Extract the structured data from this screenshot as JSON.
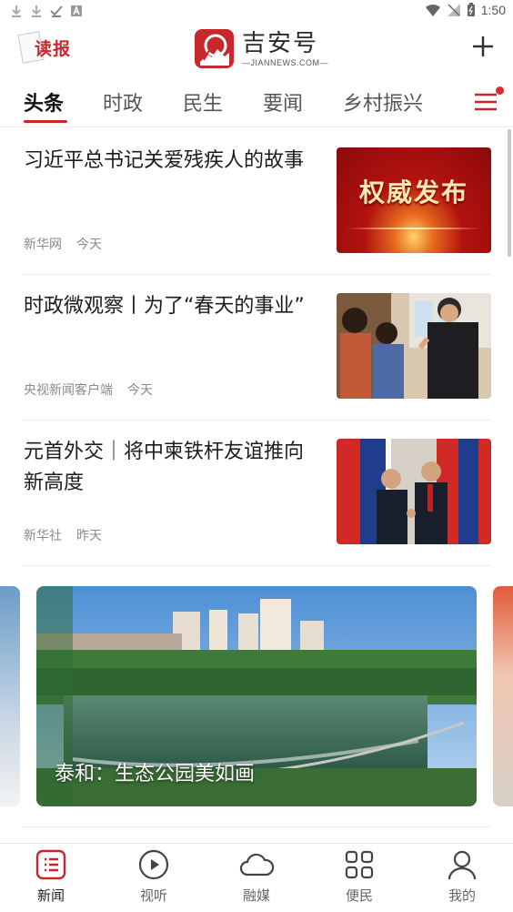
{
  "status_bar": {
    "time": "1:50"
  },
  "header": {
    "left_badge": "读报",
    "brand_title": "吉安号",
    "brand_subtitle": "—JIANNEWS.COM—"
  },
  "tabs": [
    {
      "label": "头条",
      "active": true
    },
    {
      "label": "时政"
    },
    {
      "label": "民生"
    },
    {
      "label": "要闻"
    },
    {
      "label": "乡村振兴"
    }
  ],
  "articles": [
    {
      "title": "习近平总书记关爱残疾人的故事",
      "source": "新华网",
      "time": "今天",
      "thumb_text": "权威发布"
    },
    {
      "title": "时政微观察丨为了“春天的事业”",
      "source": "央视新闻客户端",
      "time": "今天"
    },
    {
      "title": "元首外交｜将中柬铁杆友谊推向新高度",
      "source": "新华社",
      "time": "昨天"
    }
  ],
  "carousel": {
    "caption": "泰和：生态公园美如画"
  },
  "bottom_nav": [
    {
      "label": "新闻",
      "icon": "news-list-icon",
      "active": true
    },
    {
      "label": "视听",
      "icon": "play-circle-icon"
    },
    {
      "label": "融媒",
      "icon": "cloud-icon"
    },
    {
      "label": "便民",
      "icon": "grid-icon"
    },
    {
      "label": "我的",
      "icon": "person-icon"
    }
  ],
  "colors": {
    "accent": "#c9262b",
    "text": "#1c1c1c",
    "muted": "#8a8a8a"
  }
}
